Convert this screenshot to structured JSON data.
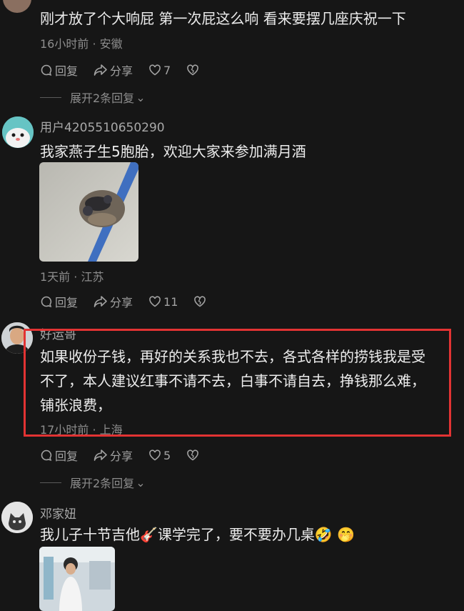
{
  "comments": [
    {
      "text": "刚才放了个大响屁 第一次屁这么响 看来要摆几座庆祝一下",
      "time": "16小时前",
      "location": "安徽",
      "reply_label": "回复",
      "share_label": "分享",
      "likes": "7",
      "expand_label": "展开2条回复"
    },
    {
      "user": "用户4205510650290",
      "text": "我家燕子生5胞胎，欢迎大家来参加满月酒",
      "time": "1天前",
      "location": "江苏",
      "reply_label": "回复",
      "share_label": "分享",
      "likes": "11"
    },
    {
      "user": "好运哥",
      "text_lines": [
        "如果收份子钱，再好的关系我也不去，各式各样的捞钱我是受",
        "不了，本人建议红事不请不去，白事不请自去，挣钱那么难，",
        "铺张浪费，"
      ],
      "time": "17小时前",
      "location": "上海",
      "reply_label": "回复",
      "share_label": "分享",
      "likes": "5",
      "expand_label": "展开2条回复"
    },
    {
      "user": "邓家妞",
      "text": "我儿子十节吉他🎸课学完了，要不要办几桌🤣 🤭"
    }
  ],
  "separator": "·",
  "colors": {
    "highlight": "#e23333",
    "background": "#161616"
  }
}
